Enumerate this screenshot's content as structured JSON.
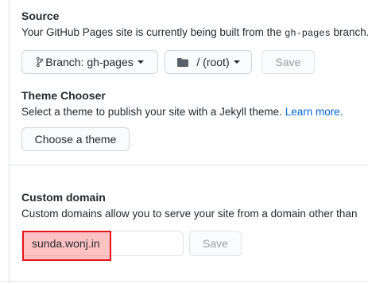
{
  "source": {
    "heading": "Source",
    "description_prefix": "Your GitHub Pages site is currently being built from the ",
    "description_code": "gh-pages",
    "description_suffix": " branch.",
    "branch_button_label": "Branch: gh-pages",
    "folder_button_label": "/ (root)",
    "save_label": "Save",
    "icons": {
      "branch": "git-branch-icon",
      "folder": "folder-icon",
      "caret": "caret-down-icon"
    }
  },
  "theme_chooser": {
    "heading": "Theme Chooser",
    "description": "Select a theme to publish your site with a Jekyll theme.",
    "learn_more_label": "Learn more.",
    "choose_button_label": "Choose a theme"
  },
  "custom_domain": {
    "heading": "Custom domain",
    "description": "Custom domains allow you to serve your site from a domain other than",
    "input_value": "sunda.wonj.in",
    "save_label": "Save",
    "highlight_color": "#e8141c"
  },
  "colors": {
    "link": "#0366d6",
    "text": "#24292e",
    "border": "#d1d5da",
    "disabled_text": "#959da5"
  }
}
